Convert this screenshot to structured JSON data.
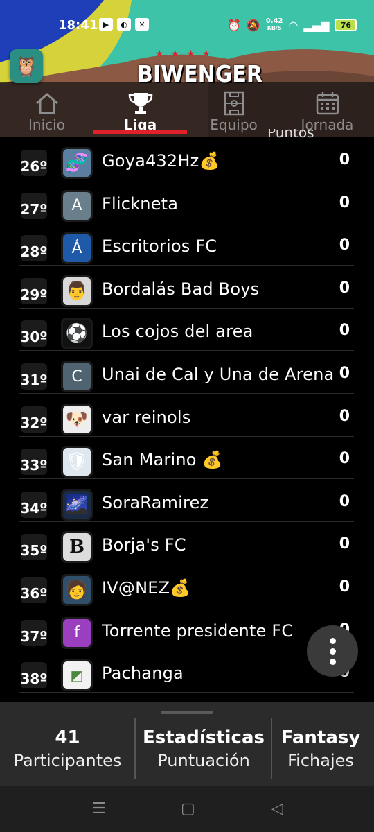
{
  "status_bar": {
    "time": "18:41",
    "speed_value": "0.42",
    "speed_unit": "KB/S",
    "battery": "76"
  },
  "brand": {
    "name": "BIWENGER",
    "stars": "★★★★"
  },
  "tabs": [
    {
      "label": "Inicio",
      "icon": "home-icon",
      "active": false
    },
    {
      "label": "Liga",
      "icon": "trophy-icon",
      "active": true
    },
    {
      "label": "Equipo",
      "icon": "field-icon",
      "active": false
    },
    {
      "label": "Jornada",
      "icon": "calendar-icon",
      "active": false
    }
  ],
  "column_header": {
    "points": "Puntos"
  },
  "standings": [
    {
      "rank": "26º",
      "name": "Goya432Hz💰",
      "points": "0",
      "avatar": "image"
    },
    {
      "rank": "27º",
      "name": "Flickneta",
      "points": "0",
      "avatar": "letter",
      "letter": "A",
      "color": "#6a7f8c"
    },
    {
      "rank": "28º",
      "name": "Escritorios FC",
      "points": "0",
      "avatar": "letter",
      "letter": "Á",
      "color": "#1f5aa8"
    },
    {
      "rank": "29º",
      "name": "Bordalás Bad Boys",
      "points": "0",
      "avatar": "image"
    },
    {
      "rank": "30º",
      "name": "Los cojos del area",
      "points": "0",
      "avatar": "image"
    },
    {
      "rank": "31º",
      "name": "Unai de Cal y Una de Arena",
      "points": "0",
      "avatar": "letter",
      "letter": "C",
      "color": "#4f6470"
    },
    {
      "rank": "32º",
      "name": "var reinols",
      "points": "0",
      "avatar": "image"
    },
    {
      "rank": "33º",
      "name": "San Marino 💰",
      "points": "0",
      "avatar": "image"
    },
    {
      "rank": "34º",
      "name": "SoraRamirez",
      "points": "0",
      "avatar": "image"
    },
    {
      "rank": "35º",
      "name": "Borja's FC",
      "points": "0",
      "avatar": "image"
    },
    {
      "rank": "36º",
      "name": "IV@NEZ💰",
      "points": "0",
      "avatar": "image"
    },
    {
      "rank": "37º",
      "name": "Torrente presidente FC",
      "points": "0",
      "avatar": "letter",
      "letter": "f",
      "color": "#9b3fc1"
    },
    {
      "rank": "38º",
      "name": "Pachanga",
      "points": "0",
      "avatar": "broken-image"
    }
  ],
  "stats": [
    {
      "value": "41",
      "label": "Participantes"
    },
    {
      "value": "Estadísticas",
      "label": "Puntuación"
    },
    {
      "value": "Fantasy",
      "label": "Fichajes"
    }
  ],
  "colors": {
    "accent": "#e0202a",
    "background": "#000000",
    "panel": "#2b2b2b"
  }
}
